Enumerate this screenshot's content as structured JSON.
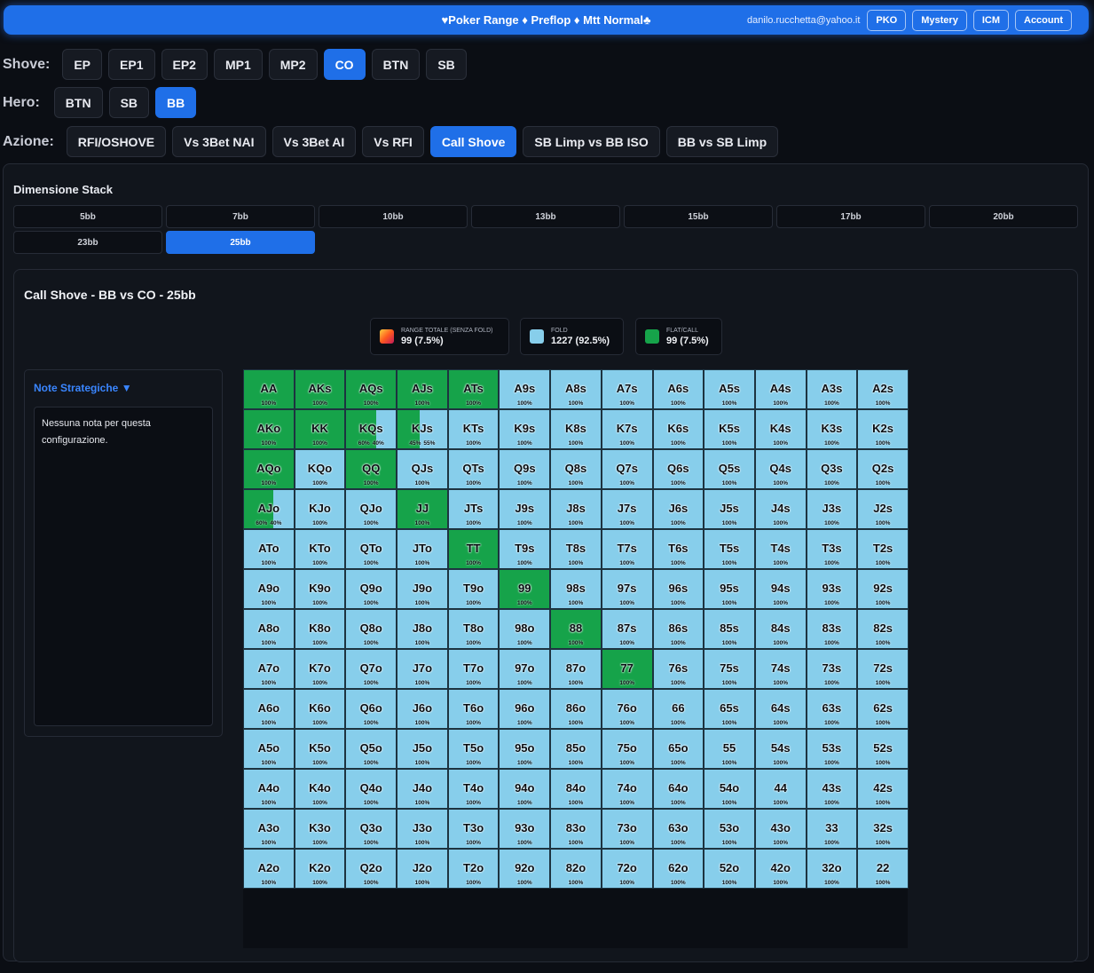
{
  "header": {
    "title": "♥Poker Range ♦ Preflop ♦ Mtt Normal♣",
    "email": "danilo.rucchetta@yahoo.it",
    "buttons": [
      "PKO",
      "Mystery",
      "ICM",
      "Account"
    ]
  },
  "shove": {
    "label": "Shove:",
    "options": [
      "EP",
      "EP1",
      "EP2",
      "MP1",
      "MP2",
      "CO",
      "BTN",
      "SB"
    ],
    "active": "CO"
  },
  "hero": {
    "label": "Hero:",
    "options": [
      "BTN",
      "SB",
      "BB"
    ],
    "active": "BB"
  },
  "azione": {
    "label": "Azione:",
    "options": [
      "RFI/OSHOVE",
      "Vs 3Bet NAI",
      "Vs 3Bet AI",
      "Vs RFI",
      "Call Shove",
      "SB Limp vs BB ISO",
      "BB vs SB Limp"
    ],
    "active": "Call Shove"
  },
  "stack": {
    "title": "Dimensione Stack",
    "options": [
      "5bb",
      "7bb",
      "10bb",
      "13bb",
      "15bb",
      "17bb",
      "20bb",
      "23bb",
      "25bb"
    ],
    "active": "25bb"
  },
  "chart_title": "Call Shove - BB vs CO - 25bb",
  "legend": [
    {
      "label": "RANGE TOTALE (SENZA FOLD)",
      "value": "99 (7.5%)",
      "color": "gradient"
    },
    {
      "label": "FOLD",
      "value": "1227 (92.5%)",
      "color": "#87ceeb"
    },
    {
      "label": "FLAT/CALL",
      "value": "99 (7.5%)",
      "color": "#16a34a"
    }
  ],
  "notes": {
    "heading": "Note Strategiche ▼",
    "body": "Nessuna nota per questa configurazione."
  },
  "colors": {
    "call": "#16a34a",
    "fold": "#87ceeb",
    "accent": "#1f6fe8"
  },
  "chart_data": {
    "type": "table",
    "ranks": [
      "A",
      "K",
      "Q",
      "J",
      "T",
      "9",
      "8",
      "7",
      "6",
      "5",
      "4",
      "3",
      "2"
    ],
    "default_pct": "100%",
    "mixed": {
      "KQs": [
        "60%",
        "40%"
      ],
      "KJs": [
        "45%",
        "55%"
      ],
      "AJo": [
        "60%",
        "40%"
      ]
    },
    "mixed_call_fraction": {
      "KQs": 0.6,
      "KJs": 0.45,
      "AJo": 0.6
    },
    "call_hands": [
      "AA",
      "AKs",
      "AQs",
      "AJs",
      "ATs",
      "AKo",
      "KK",
      "AQo",
      "QQ",
      "JJ",
      "TT",
      "99",
      "88",
      "77"
    ]
  }
}
